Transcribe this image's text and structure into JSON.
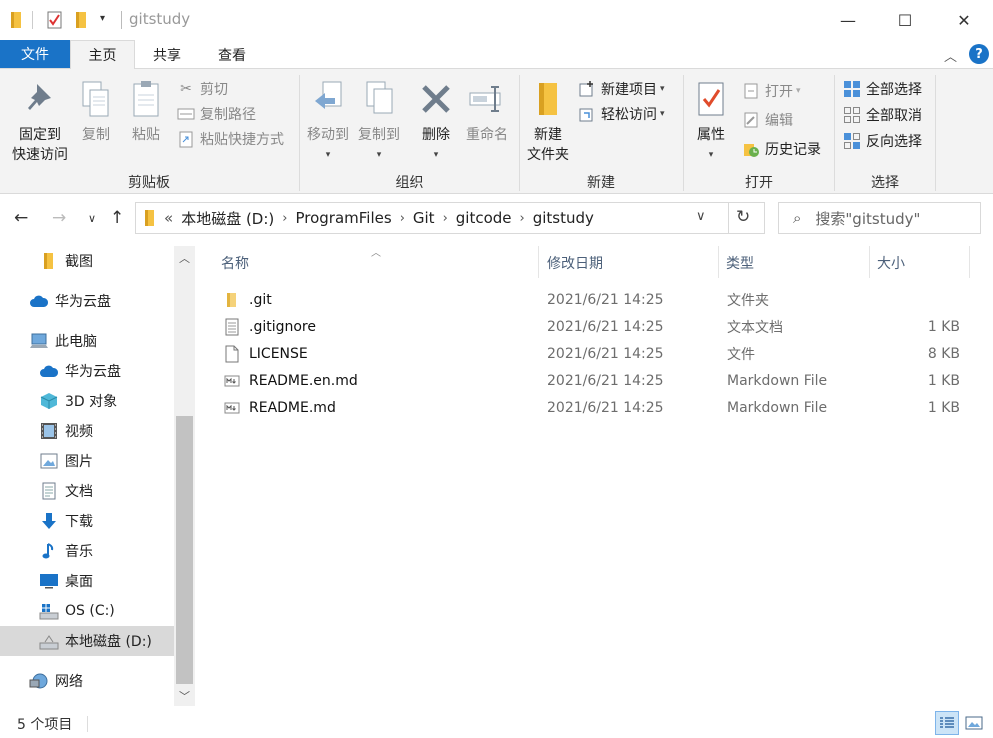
{
  "window": {
    "title": "gitstudy",
    "minimize": "—",
    "maximize": "☐",
    "close": "✕"
  },
  "ribbon_tabs": {
    "file": "文件",
    "home": "主页",
    "share": "共享",
    "view": "查看",
    "help": "?"
  },
  "clipboard": {
    "pin_line1": "固定到",
    "pin_line2": "快速访问",
    "copy": "复制",
    "paste": "粘贴",
    "cut": "剪切",
    "copy_path": "复制路径",
    "paste_shortcut": "粘贴快捷方式",
    "label": "剪贴板"
  },
  "organize": {
    "move_to": "移动到",
    "copy_to": "复制到",
    "delete": "删除",
    "rename": "重命名",
    "label": "组织"
  },
  "new_group": {
    "new_folder_line1": "新建",
    "new_folder_line2": "文件夹",
    "new_item": "新建项目",
    "easy_access": "轻松访问",
    "label": "新建"
  },
  "open_group": {
    "properties": "属性",
    "open": "打开",
    "edit": "编辑",
    "history": "历史记录",
    "label": "打开"
  },
  "select_group": {
    "select_all": "全部选择",
    "select_none": "全部取消",
    "invert": "反向选择",
    "label": "选择"
  },
  "address": {
    "chevron": "«",
    "crumbs": [
      "本地磁盘 (D:)",
      "ProgramFiles",
      "Git",
      "gitcode",
      "gitstudy"
    ],
    "search_placeholder": "搜索\"gitstudy\""
  },
  "nav_pane": {
    "items": [
      {
        "label": "截图",
        "icon": "folder-icon"
      },
      {
        "label": "华为云盘",
        "icon": "cloud-icon"
      },
      {
        "label": "此电脑",
        "icon": "computer-icon"
      },
      {
        "label": "华为云盘",
        "icon": "cloud-icon"
      },
      {
        "label": "3D 对象",
        "icon": "cube-icon"
      },
      {
        "label": "视频",
        "icon": "film-icon"
      },
      {
        "label": "图片",
        "icon": "picture-icon"
      },
      {
        "label": "文档",
        "icon": "document-icon"
      },
      {
        "label": "下载",
        "icon": "download-icon"
      },
      {
        "label": "音乐",
        "icon": "music-icon"
      },
      {
        "label": "桌面",
        "icon": "desktop-icon"
      },
      {
        "label": "OS (C:)",
        "icon": "os-drive-icon"
      },
      {
        "label": "本地磁盘 (D:)",
        "icon": "drive-icon"
      },
      {
        "label": "网络",
        "icon": "network-icon"
      }
    ]
  },
  "file_list": {
    "columns": {
      "name": "名称",
      "modified": "修改日期",
      "type": "类型",
      "size": "大小"
    },
    "rows": [
      {
        "name": ".git",
        "modified": "2021/6/21 14:25",
        "type": "文件夹",
        "size": "",
        "icon": "folder-icon"
      },
      {
        "name": ".gitignore",
        "modified": "2021/6/21 14:25",
        "type": "文本文档",
        "size": "1 KB",
        "icon": "text-file-icon"
      },
      {
        "name": "LICENSE",
        "modified": "2021/6/21 14:25",
        "type": "文件",
        "size": "8 KB",
        "icon": "blank-file-icon"
      },
      {
        "name": "README.en.md",
        "modified": "2021/6/21 14:25",
        "type": "Markdown File",
        "size": "1 KB",
        "icon": "markdown-file-icon"
      },
      {
        "name": "README.md",
        "modified": "2021/6/21 14:25",
        "type": "Markdown File",
        "size": "1 KB",
        "icon": "markdown-file-icon"
      }
    ]
  },
  "status": {
    "item_count": "5 个项目"
  },
  "colors": {
    "accent": "#1a73c7",
    "folder": "#f5c242",
    "selected_nav": "#d9d9d9"
  }
}
